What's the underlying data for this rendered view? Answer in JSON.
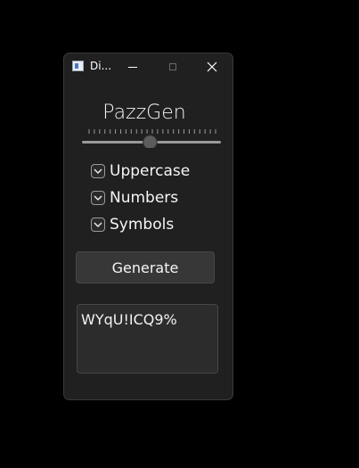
{
  "window": {
    "title": "Di..."
  },
  "app": {
    "heading": "PazzGen"
  },
  "length_slider": {
    "level_fraction": 0.49
  },
  "options": [
    {
      "label": "Uppercase",
      "checked": true
    },
    {
      "label": "Numbers",
      "checked": true
    },
    {
      "label": "Symbols",
      "checked": true
    }
  ],
  "generate_button": {
    "label": "Generate"
  },
  "output": {
    "value": "WYqU!ICQ9%"
  },
  "colors": {
    "window_bg": "#202020",
    "page_bg": "#000000",
    "text": "#f5f5f5",
    "slider_track": "#9a9a9a",
    "slider_thumb": "#5c5c5c"
  }
}
